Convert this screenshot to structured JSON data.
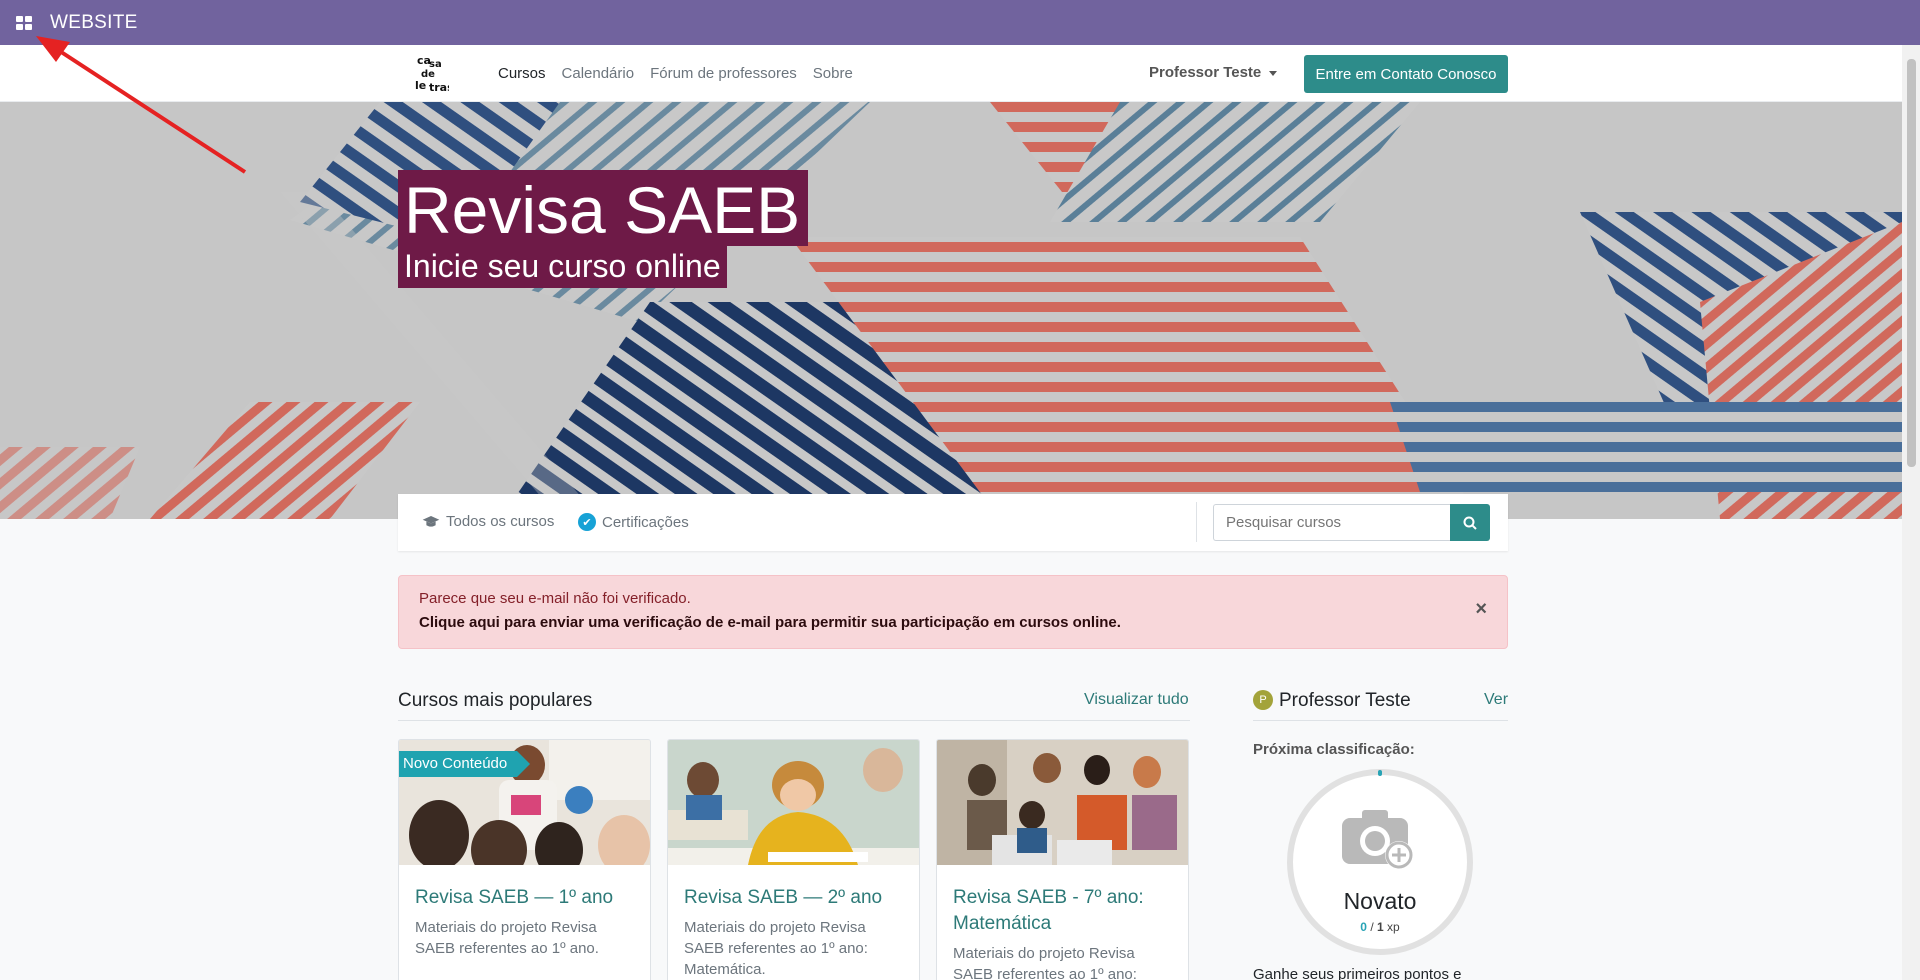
{
  "topbar": {
    "title": "WEBSITE",
    "apps_icon": "apps-grid-icon",
    "background": "#71639e"
  },
  "navbar": {
    "logo_text": "Casa de Letras",
    "links": [
      {
        "label": "Cursos",
        "active": true
      },
      {
        "label": "Calendário",
        "active": false
      },
      {
        "label": "Fórum de professores",
        "active": false
      },
      {
        "label": "Sobre",
        "active": false
      }
    ],
    "user": "Professor Teste",
    "contact_button": "Entre em Contato Conosco",
    "accent": "#2d8c8a"
  },
  "hero": {
    "title": "Revisa SAEB",
    "subtitle": "Inicie seu curso online",
    "title_bg": "#6e1a47"
  },
  "filters": {
    "all_courses": "Todos os cursos",
    "certifications": "Certificações",
    "search_placeholder": "Pesquisar cursos"
  },
  "alert": {
    "line1": "Parece que seu e-mail não foi verificado.",
    "line2": "Clique aqui para enviar uma verificação de e-mail para permitir sua participação em cursos online.",
    "close": "×"
  },
  "popular": {
    "title": "Cursos mais populares",
    "view_all": "Visualizar tudo",
    "courses": [
      {
        "ribbon": "Novo Conteúdo",
        "title": "Revisa SAEB — 1º ano",
        "desc": "Materiais do projeto Revisa SAEB referentes ao 1º ano."
      },
      {
        "ribbon": "",
        "title": "Revisa SAEB — 2º ano",
        "desc": "Materiais do projeto Revisa SAEB referentes ao 1º ano: Matemática."
      },
      {
        "ribbon": "",
        "title": "Revisa SAEB - 7º ano: Matemática",
        "desc": "Materiais do projeto Revisa SAEB referentes ao 1º ano:"
      }
    ]
  },
  "profile": {
    "initial": "P",
    "name": "Professor Teste",
    "view_link": "Ver",
    "next_rank_label": "Próxima classificação:",
    "rank_name": "Novato",
    "xp_current": "0",
    "xp_sep": " / ",
    "xp_total": "1",
    "xp_unit": " xp",
    "gain_text": "Ganhe seus primeiros pontos e"
  }
}
